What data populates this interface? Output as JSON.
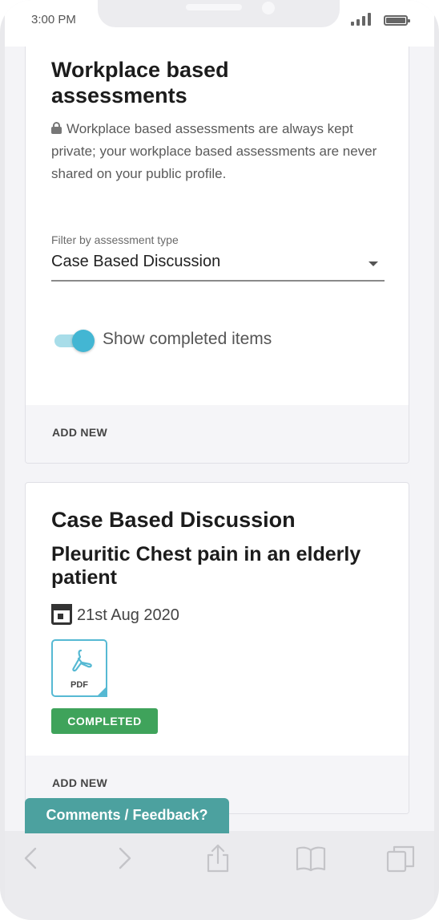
{
  "status_bar": {
    "time": "3:00 PM"
  },
  "assessments_card": {
    "title": "Workplace based assessments",
    "privacy_note": "Workplace based assessments are always kept private; your workplace based assessments are never shared on your public profile.",
    "filter_label": "Filter by assessment type",
    "filter_value": "Case Based Discussion",
    "toggle_label": "Show completed items",
    "toggle_on": true,
    "add_new_label": "ADD NEW"
  },
  "assessment_item": {
    "type": "Case Based Discussion",
    "title": "Pleuritic Chest pain in an elderly patient",
    "date": "21st Aug 2020",
    "attachment_label": "PDF",
    "status": "COMPLETED",
    "status_color": "#3fa35b",
    "add_new_label": "ADD NEW"
  },
  "feedback_button": {
    "label": "Comments / Feedback?",
    "color": "#4ca19f"
  },
  "colors": {
    "accent": "#43b6d3",
    "pdf_border": "#56b9d3"
  },
  "toolbar_icons": [
    "chevron-left-icon",
    "chevron-right-icon",
    "share-icon",
    "book-icon",
    "tabs-icon"
  ]
}
